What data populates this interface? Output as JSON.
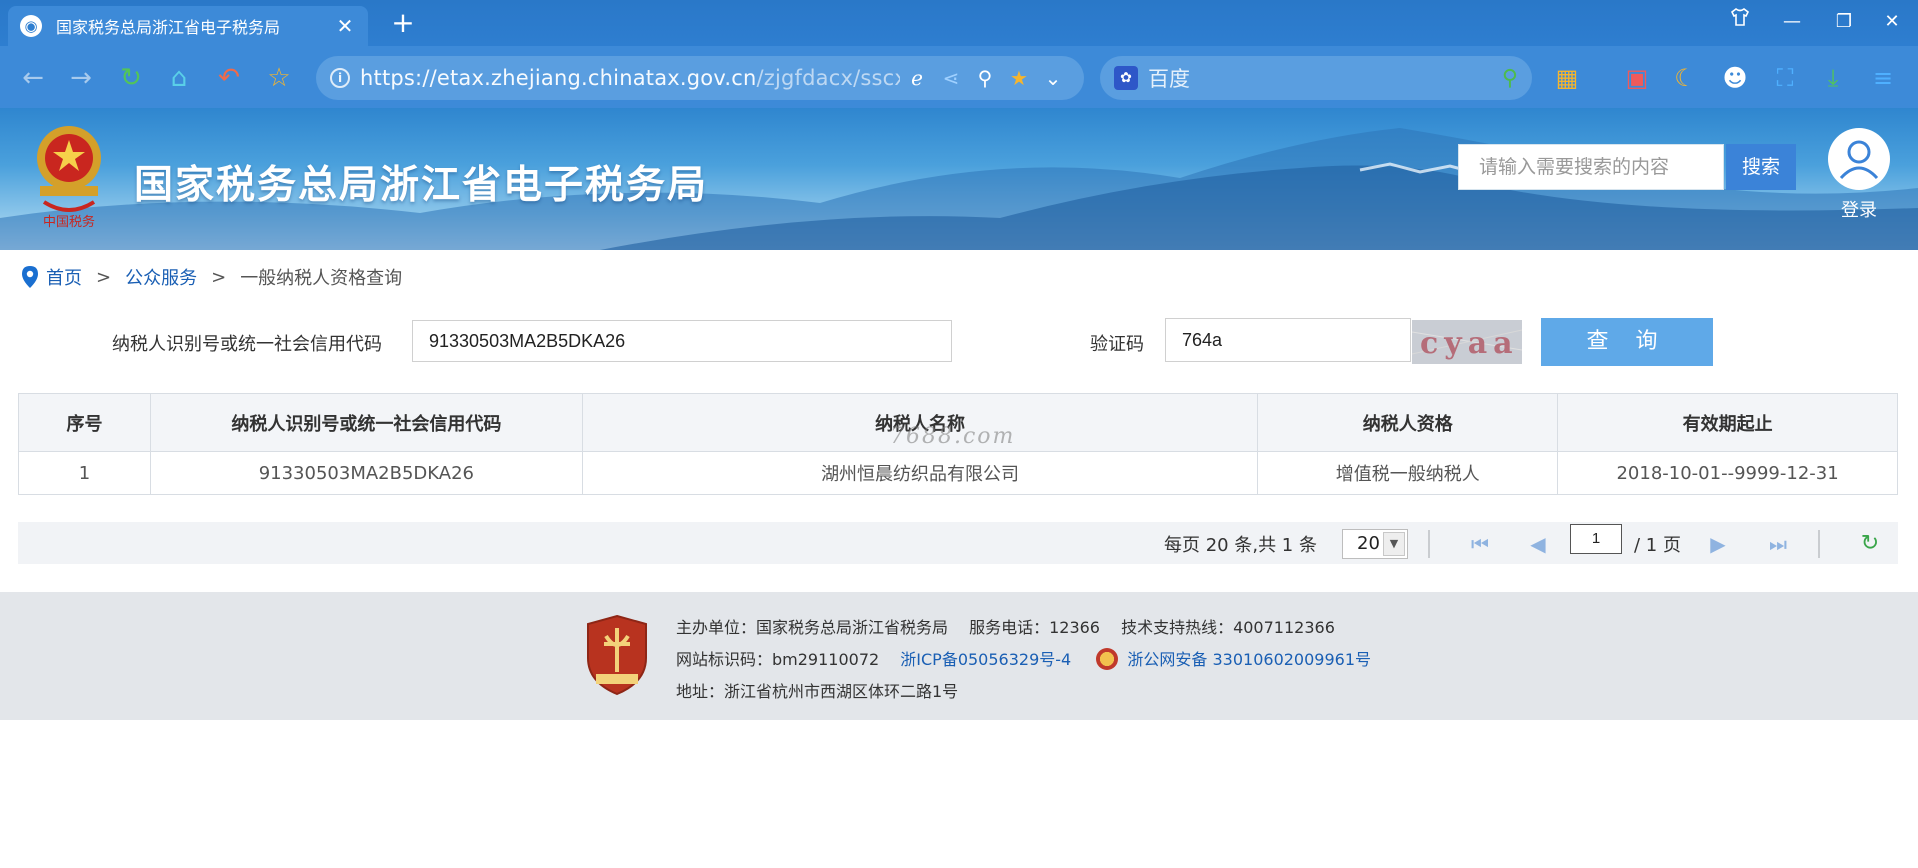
{
  "browser": {
    "tab_title": "国家税务总局浙江省电子税务局",
    "url_main": "https://etax.zhejiang.chinatax.gov.cn",
    "url_rest": "/zjgfdacx/sscx/...",
    "search_engine": "百度"
  },
  "header": {
    "site_title": "国家税务总局浙江省电子税务局",
    "search_placeholder": "请输入需要搜索的内容",
    "search_button": "搜索",
    "login_label": "登录"
  },
  "breadcrumb": {
    "home": "首页",
    "sep1": ">",
    "section": "公众服务",
    "sep2": ">",
    "current": "一般纳税人资格查询"
  },
  "form": {
    "code_label": "纳税人识别号或统一社会信用代码",
    "code_value": "91330503MA2B5DKA26",
    "captcha_label": "验证码",
    "captcha_value": "764a",
    "captcha_image_text": "cyaa",
    "query_button": "查 询"
  },
  "table": {
    "headers": [
      "序号",
      "纳税人识别号或统一社会信用代码",
      "纳税人名称",
      "纳税人资格",
      "有效期起止"
    ],
    "rows": [
      [
        "1",
        "91330503MA2B5DKA26",
        "湖州恒晨纺织品有限公司",
        "增值税一般纳税人",
        "2018-10-01--9999-12-31"
      ]
    ],
    "watermark": "7688.com"
  },
  "pager": {
    "info": "每页 20 条,共 1 条",
    "page_size": "20",
    "current_page": "1",
    "total_pages": "/ 1 页"
  },
  "footer": {
    "line1": "主办单位：国家税务总局浙江省税务局　 服务电话：12366　 技术支持热线：4007112366",
    "site_id": "网站标识码：bm29110072",
    "icp": "浙ICP备05056329号-4",
    "police": "浙公网安备 33010602009961号",
    "address": "地址：浙江省杭州市西湖区体环二路1号"
  },
  "colors": {
    "accent": "#3b83d8",
    "query_button": "#5fa9e8",
    "link": "#1a5fb4",
    "browser_chrome": "#3d8ad8"
  }
}
